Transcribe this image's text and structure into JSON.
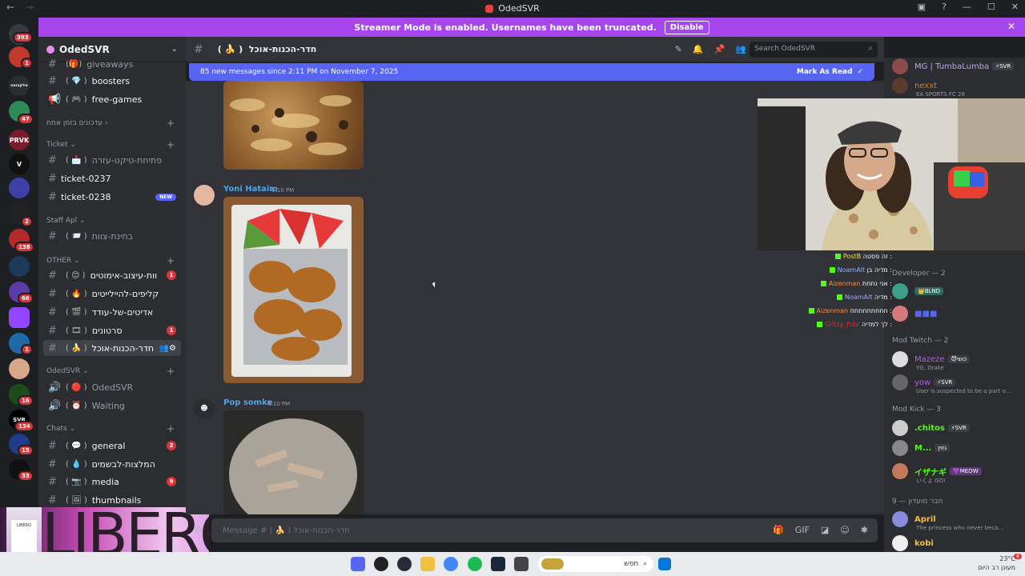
{
  "window": {
    "title": "OdedSVR",
    "back": "←",
    "forward": "→"
  },
  "banner": {
    "text": "Streamer Mode is enabled. Usernames have been truncated.",
    "disable": "Disable",
    "close": "✕"
  },
  "rail_badges": [
    "393",
    "1",
    "47",
    "2",
    "138",
    "66",
    "1",
    "16",
    "134",
    "15",
    "33"
  ],
  "server": {
    "name": "OdedSVR"
  },
  "channels": {
    "giveaways": "giveaways",
    "boosters": "boosters",
    "free_games": "free-games",
    "cat_live": "עדכונים בזמן אמת",
    "cat_ticket": "Ticket",
    "open_ticket": "פתיחת-טיקט-עזרה",
    "ticket_0237": "ticket-0237",
    "ticket_0238": "ticket-0238",
    "new_badge": "NEW",
    "cat_staff": "Staff Apl",
    "staff_test": "בחינת-צוות",
    "cat_other": "OTHER",
    "design": "וות-עיצוב-אימוטים",
    "clips": "קליפים-להיילייטים",
    "edits": "אדיטים-של-עודד",
    "videos": "סרטונים",
    "food": "חדר-הכנות-אוכל",
    "cat_odedsvr": "OdedSVR",
    "voice_odedsvr": "OdedSVR",
    "voice_waiting": "Waiting",
    "cat_chats": "Chats",
    "general": "general",
    "recommend": "המלצות-לבשמים",
    "media": "media",
    "thumbnails": "thumbnails",
    "badge_design": "1",
    "badge_videos": "1",
    "badge_general": "2",
    "badge_media": "9"
  },
  "header": {
    "channel": "חדר-הכנות-אוכל",
    "search": "Search OdedSVR"
  },
  "newbar": {
    "text": "85 new messages since 2:11 PM on November 7, 2025",
    "mark": "Mark As Read"
  },
  "messages": [
    {
      "author": "Yoni Hataim",
      "time": "6:10 PM",
      "color": "#4fa4e8"
    },
    {
      "author": "Pop somke",
      "time": "6:10 PM",
      "color": "#4fa4e8"
    }
  ],
  "composer": {
    "placeholder": "Message # ( 🍌 ) חדר-הכנות-אוכל"
  },
  "members": {
    "top1": "MG | TumbaLumba",
    "top1_tag": "⚡SVR",
    "top2": "nexxt",
    "top2_sub": "EA SPORTS FC 26",
    "cat_dev": "Developer — 2",
    "dev_tag": "👑BLND",
    "cat_modtw": "Mod Twitch — 2",
    "mazeze": "Mazeze",
    "mazeze_tag": "😈כושי",
    "mazeze_sub": "YG, Drake",
    "yow": "yow",
    "yow_tag": "⚡SVR",
    "yow_sub": "User is suspected to be a part o...",
    "cat_modkick": "Mod Kick — 3",
    "chitos": ".chitos",
    "chitos_tag": "⚡SVR",
    "m": "M...",
    "m_tag": "גזוין",
    "iza": "イザナギ",
    "iza_tag": "💜MEOW",
    "iza_sub": "いくよ GO!",
    "cat_club": "חבר מועדון — 9",
    "april": "April",
    "april_sub": "The princess who never beca...",
    "kobi": "kobi"
  },
  "chat_overlay": [
    {
      "name": "PostB",
      "msg": "זה פסטה :",
      "color": "#f0e040"
    },
    {
      "name": "NoamAlt",
      "msg": "מדיה בן :",
      "color": "#8fb3ff"
    },
    {
      "name": "Aizenman",
      "msg": "אני נתחת :",
      "color": "#ff8a3d"
    },
    {
      "name": "NoamAlt",
      "msg": "מדיה :",
      "color": "#8fb3ff"
    },
    {
      "name": "Aizenman",
      "msg": "חחחחחחחחח :",
      "color": "#ff8a3d"
    },
    {
      "name": "Glitzy_fnbr",
      "msg": "לך למדיה :",
      "color": "#e8262b"
    }
  ],
  "libero": {
    "word": "LIBERO"
  },
  "taskbar": {
    "search": "חפש",
    "temp": "23°C",
    "weather": "מעונן רב היום",
    "notif": "8"
  }
}
